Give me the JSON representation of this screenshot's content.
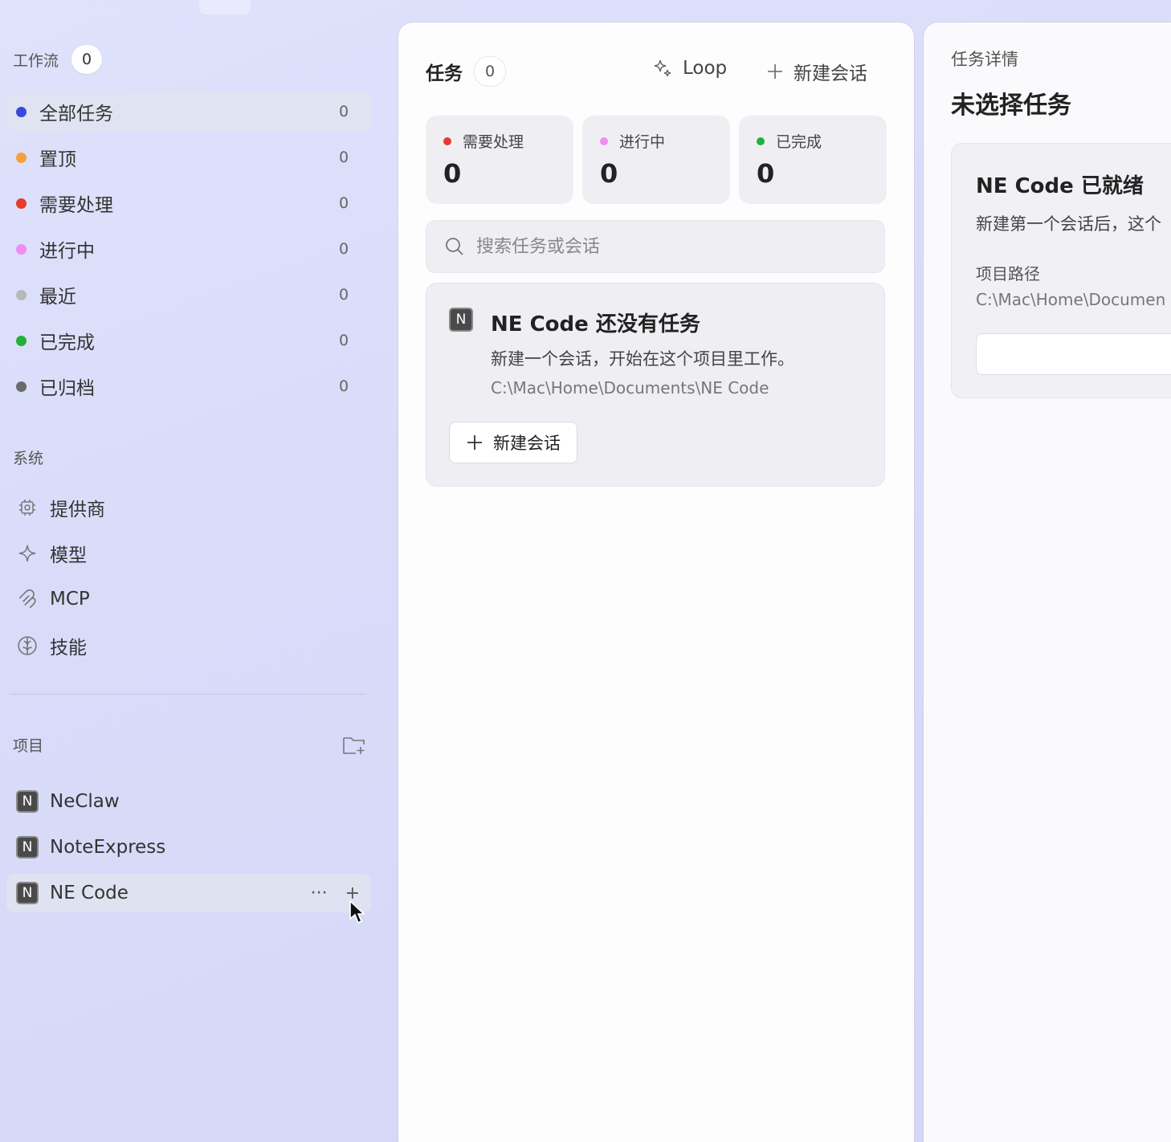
{
  "colors": {
    "blue": "#3b48e0",
    "orange": "#f5a03a",
    "red": "#e8392a",
    "pink": "#ee8ef0",
    "gray": "#b8b8b8",
    "green": "#22b03a",
    "darkgray": "#6a6a6a"
  },
  "sidebar": {
    "workflow": {
      "label": "工作流",
      "count": "0"
    },
    "items": [
      {
        "label": "全部任务",
        "count": "0",
        "color": "#3b48e0"
      },
      {
        "label": "置顶",
        "count": "0",
        "color": "#f5a03a"
      },
      {
        "label": "需要处理",
        "count": "0",
        "color": "#e8392a"
      },
      {
        "label": "进行中",
        "count": "0",
        "color": "#ee8ef0"
      },
      {
        "label": "最近",
        "count": "0",
        "color": "#b8b8b8"
      },
      {
        "label": "已完成",
        "count": "0",
        "color": "#22b03a"
      },
      {
        "label": "已归档",
        "count": "0",
        "color": "#6a6a6a"
      }
    ],
    "system": {
      "label": "系统",
      "items": [
        {
          "label": "提供商",
          "icon": "chip-icon"
        },
        {
          "label": "模型",
          "icon": "sparkle-icon"
        },
        {
          "label": "MCP",
          "icon": "mcp-icon"
        },
        {
          "label": "技能",
          "icon": "brain-icon"
        }
      ]
    },
    "projects": {
      "label": "项目",
      "items": [
        {
          "label": "NeClaw",
          "badge": "N"
        },
        {
          "label": "NoteExpress",
          "badge": "N"
        },
        {
          "label": "NE Code",
          "badge": "N"
        }
      ],
      "more": "···",
      "add": "+"
    }
  },
  "tasks": {
    "title": "任务",
    "count": "0",
    "loop_label": "Loop",
    "new_session_label": "新建会话",
    "stats": [
      {
        "label": "需要处理",
        "value": "0",
        "color": "#e8392a"
      },
      {
        "label": "进行中",
        "value": "0",
        "color": "#ee8ef0"
      },
      {
        "label": "已完成",
        "value": "0",
        "color": "#22b03a"
      }
    ],
    "search_placeholder": "搜索任务或会话",
    "empty": {
      "badge": "N",
      "title": "NE Code 还没有任务",
      "desc": "新建一个会话，开始在这个项目里工作。",
      "path": "C:\\Mac\\Home\\Documents\\NE Code",
      "button": "新建会话"
    }
  },
  "detail": {
    "subtitle": "任务详情",
    "title": "未选择任务",
    "card": {
      "title": "NE Code 已就绪",
      "desc": "新建第一个会话后，这个",
      "path_label": "项目路径",
      "path": "C:\\Mac\\Home\\Documen"
    }
  }
}
